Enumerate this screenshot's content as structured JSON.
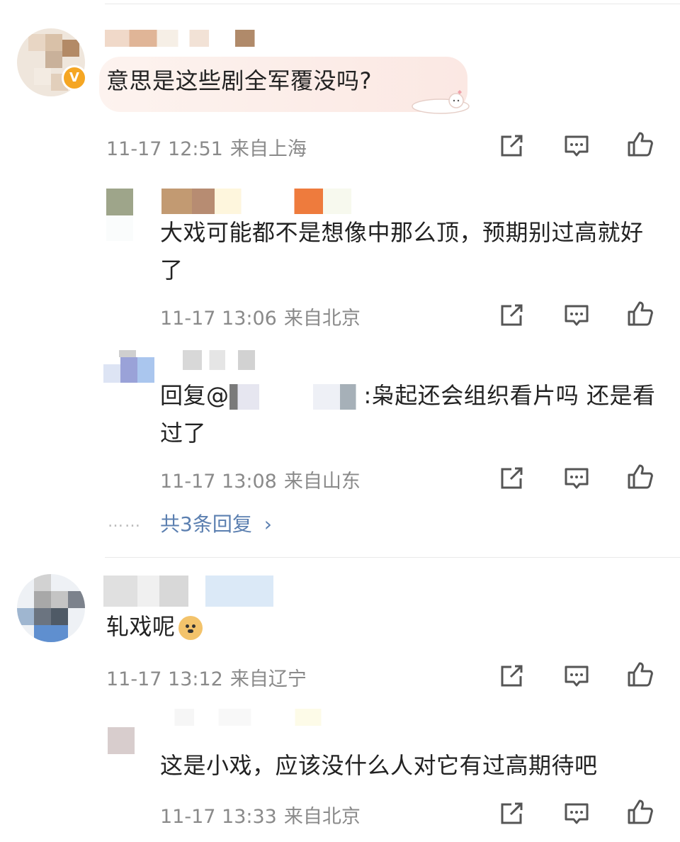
{
  "comments": [
    {
      "text": "意思是这些剧全军覆没吗?",
      "date": "11-17 12:51",
      "location": "来自上海",
      "verified_mark": "V",
      "replies": [
        {
          "text": "大戏可能都不是想像中那么顶，预期别过高就好了",
          "date": "11-17 13:06",
          "location": "来自北京"
        },
        {
          "text_prefix": "回复@",
          "text_suffix": ":枭起还会组织看片吗 还是看过了",
          "date": "11-17 13:08",
          "location": "来自山东"
        }
      ],
      "more_replies": {
        "dots": "……",
        "label": "共3条回复",
        "chevron": "›"
      }
    },
    {
      "text": "轧戏呢",
      "emoji": "doge-emoji",
      "date": "11-17 13:12",
      "location": "来自辽宁",
      "replies": [
        {
          "text": "这是小戏，应该没什么人对它有过高期待吧",
          "date": "11-17 13:33",
          "location": "来自北京"
        }
      ]
    }
  ],
  "icons": {
    "share": "share-icon",
    "comment": "comment-icon",
    "like": "like-icon"
  },
  "colors": {
    "meta_text": "#8a8a8a",
    "link": "#5b7fb0",
    "verified": "#f5a623"
  }
}
